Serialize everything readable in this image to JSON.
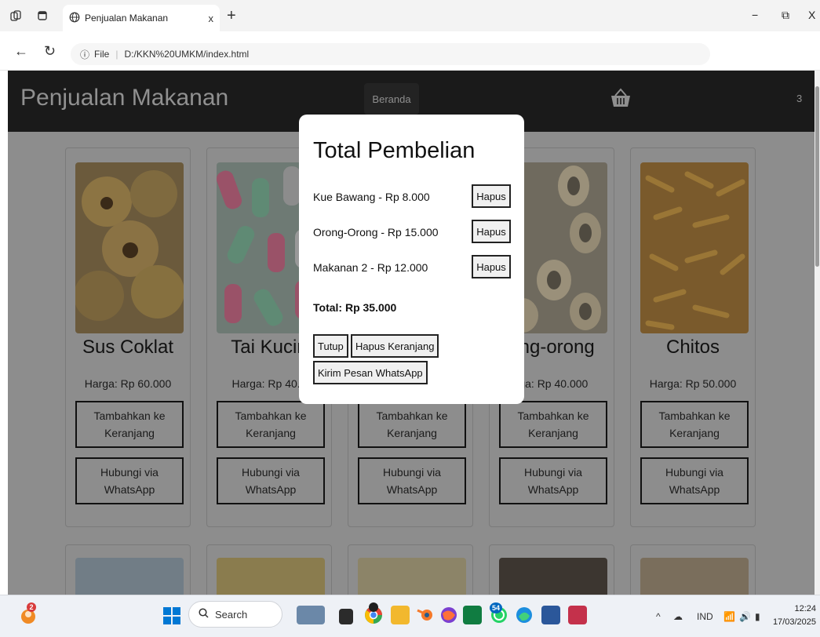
{
  "browser": {
    "tab_title": "Penjualan Makanan",
    "tab_close": "x",
    "new_tab": "+",
    "omnibox_scheme": "File",
    "omnibox_sep": "|",
    "url": "D:/KKN%20UMKM/index.html",
    "minimize": "−",
    "restore": "⧉",
    "close": "X",
    "more": "···"
  },
  "site": {
    "title": "Penjualan Makanan",
    "nav_home": "Beranda",
    "cart_count": "3"
  },
  "products": [
    {
      "name": "Sus Coklat",
      "price": "Harga: Rp 60.000",
      "add_label": "Tambahkan ke Keranjang",
      "wa_label": "Hubungi via WhatsApp"
    },
    {
      "name": "Tai Kucin",
      "price": "Harga: Rp 40.0",
      "add_label": "Tambahkan ke Keranjang",
      "wa_label": "Hubungi via WhatsApp"
    },
    {
      "name": "",
      "price": "",
      "add_label": "Tambahkan ke Keranjang",
      "wa_label": "Hubungi via WhatsApp"
    },
    {
      "name": "ong-orong",
      "price": "rga: Rp 40.000",
      "add_label": "Tambahkan ke Keranjang",
      "wa_label": "Hubungi via WhatsApp"
    },
    {
      "name": "Chitos",
      "price": "Harga: Rp 50.000",
      "add_label": "Tambahkan ke Keranjang",
      "wa_label": "Hubungi via WhatsApp"
    }
  ],
  "modal": {
    "title": "Total Pembelian",
    "items": [
      {
        "text": "Kue Bawang - Rp 8.000",
        "remove_label": "Hapus"
      },
      {
        "text": "Orong-Orong - Rp 15.000",
        "remove_label": "Hapus"
      },
      {
        "text": "Makanan 2 - Rp 12.000",
        "remove_label": "Hapus"
      }
    ],
    "total": "Total: Rp 35.000",
    "close_label": "Tutup",
    "clear_label": "Hapus Keranjang",
    "send_label": "Kirim Pesan WhatsApp"
  },
  "taskbar": {
    "search_placeholder": "Search",
    "lang": "IND",
    "time": "12:24",
    "date": "17/03/2025",
    "chat_badge": "2",
    "chrome_badge": "54"
  },
  "colors": {
    "overlay": "#8d8d8d",
    "header": "#1a1a1a",
    "modal_bg": "#ffffff",
    "accent_blue": "#0078d4"
  }
}
